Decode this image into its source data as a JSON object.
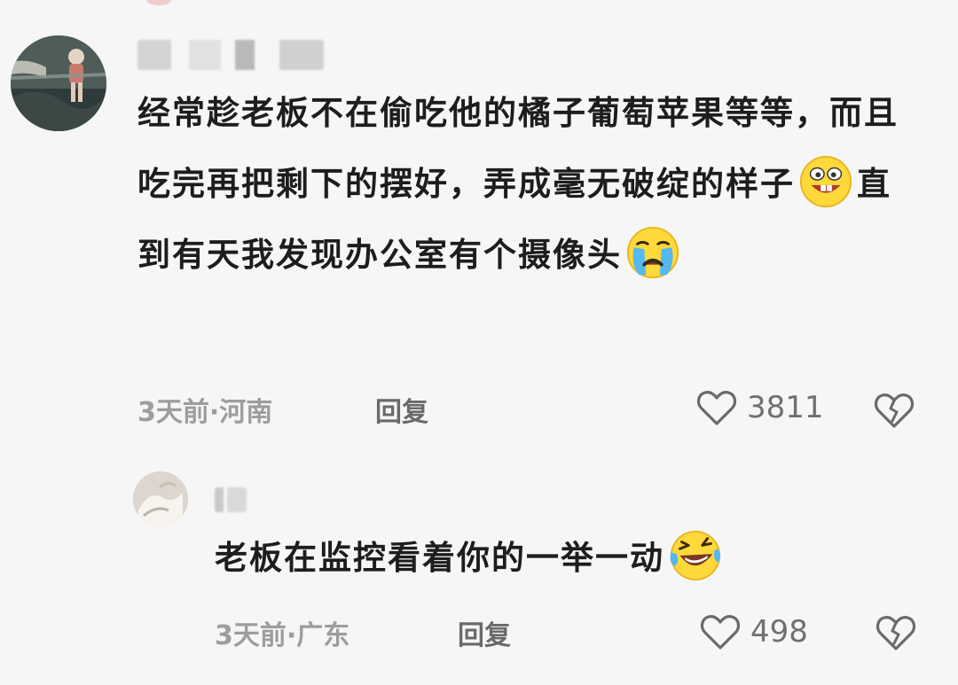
{
  "comments": [
    {
      "text_parts": [
        "经常趁老板不在偷吃他的橘子葡萄苹果等等，而且吃完再把剩下的摆好，弄成毫无破绽的样子",
        "直到有天我发现办公室有个摄像头"
      ],
      "emojis": [
        "grinning-emoji",
        "crying-emoji"
      ],
      "time": "3天前",
      "separator": "·",
      "location": "河南",
      "reply_label": "回复",
      "likes": "3811"
    },
    {
      "text_parts": [
        "老板在监控看着你的一举一动"
      ],
      "emojis": [
        "laughing-tears-emoji"
      ],
      "time": "3天前",
      "separator": "·",
      "location": "广东",
      "reply_label": "回复",
      "likes": "498"
    }
  ]
}
